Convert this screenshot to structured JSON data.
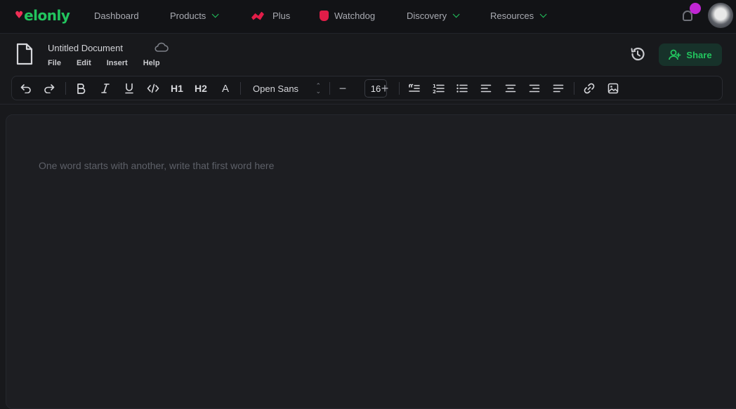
{
  "brand": {
    "name": "elonly",
    "heart": "♥",
    "color": "#22c55e",
    "heart_color": "#ef2e55"
  },
  "nav": {
    "items": [
      {
        "label": "Dashboard",
        "has_dropdown": false
      },
      {
        "label": "Products",
        "has_dropdown": true
      },
      {
        "label": "Plus",
        "icon": "plus-chart-icon",
        "has_dropdown": false
      },
      {
        "label": "Watchdog",
        "icon": "watchdog-icon",
        "has_dropdown": false
      },
      {
        "label": "Discovery",
        "has_dropdown": true
      },
      {
        "label": "Resources",
        "has_dropdown": true
      }
    ],
    "notification_icon": "bell-icon",
    "badge_color": "#c026d3"
  },
  "document": {
    "title": "Untitled Document",
    "menu": [
      "File",
      "Edit",
      "Insert",
      "Help"
    ],
    "sync_icon": "cloud-icon",
    "history_icon": "history-icon",
    "share_label": "Share"
  },
  "toolbar": {
    "font_family": "Open Sans",
    "font_size": "16",
    "buttons": [
      "undo-icon",
      "redo-icon",
      "bold-icon",
      "italic-icon",
      "underline-icon",
      "code-icon",
      "heading-1-icon",
      "heading-2-icon",
      "text-color-icon",
      "decrease-size-icon",
      "increase-size-icon",
      "blockquote-icon",
      "ordered-list-icon",
      "bullet-list-icon",
      "align-left-icon",
      "align-center-icon",
      "align-right-icon",
      "align-justify-icon",
      "link-icon",
      "image-icon"
    ],
    "labels": {
      "h1": "H1",
      "h2": "H2",
      "text_color": "A",
      "minus": "−",
      "plus": "+"
    }
  },
  "editor": {
    "placeholder": "One word starts with another, write that first word here"
  },
  "colors": {
    "background": "#18191c",
    "topbar": "#121316",
    "accent": "#22c55e",
    "share_bg": "#17322a"
  }
}
